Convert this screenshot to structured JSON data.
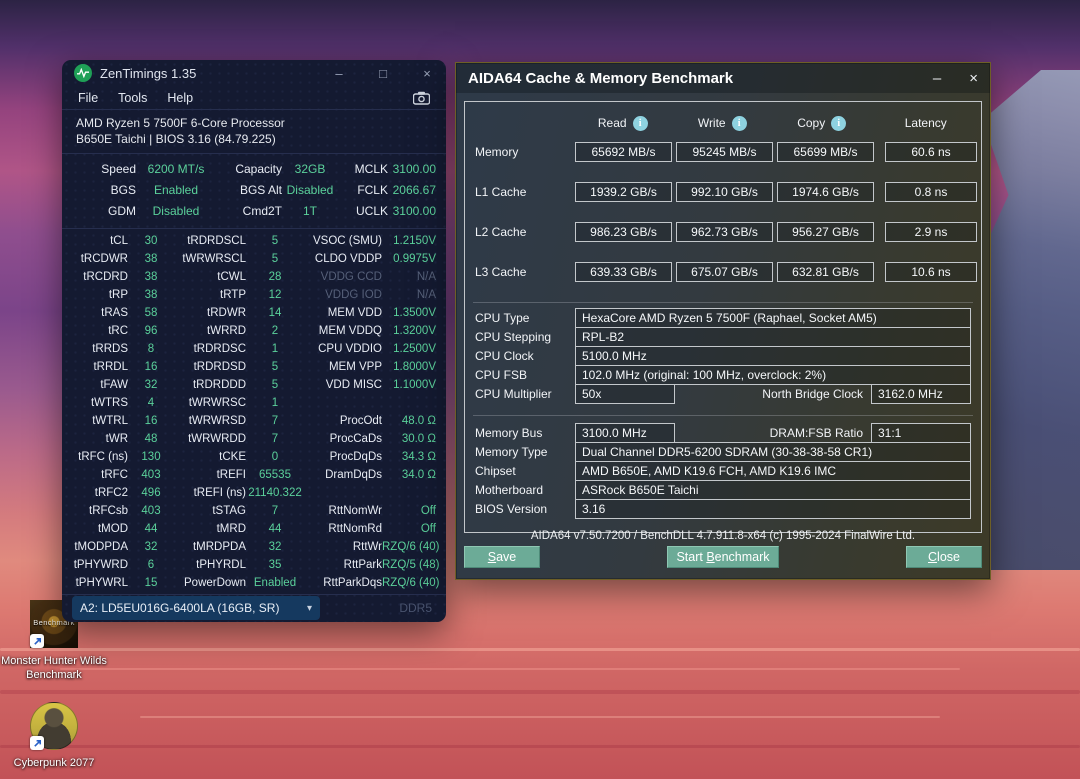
{
  "colors": {
    "accent_green": "#5bd19b",
    "button_teal": "#6cab97",
    "info_icon_blue": "#8ed2e0",
    "zentimings_bg": "#141a31"
  },
  "icons": {
    "minimize": "–",
    "maximize": "□",
    "close": "×",
    "dropdown_caret": "▾",
    "info": "i"
  },
  "zentimings": {
    "title": "ZenTimings 1.35",
    "menu": {
      "file": "File",
      "tools": "Tools",
      "help": "Help"
    },
    "cpu_line1": "AMD Ryzen 5 7500F 6-Core Processor",
    "cpu_line2": "B650E Taichi | BIOS 3.16 (84.79.225)",
    "speed_rows": [
      [
        "Speed",
        "6200 MT/s",
        "Capacity",
        "32GB",
        "MCLK",
        "3100.00"
      ],
      [
        "BGS",
        "Enabled",
        "BGS Alt",
        "Disabled",
        "FCLK",
        "2066.67"
      ],
      [
        "GDM",
        "Disabled",
        "Cmd2T",
        "1T",
        "UCLK",
        "3100.00"
      ]
    ],
    "timing_rows": [
      [
        "tCL",
        "30",
        "tRDRDSCL",
        "5",
        "VSOC (SMU)",
        "1.2150V"
      ],
      [
        "tRCDWR",
        "38",
        "tWRWRSCL",
        "5",
        "CLDO VDDP",
        "0.9975V"
      ],
      [
        "tRCDRD",
        "38",
        "tCWL",
        "28",
        "VDDG CCD",
        "N/A"
      ],
      [
        "tRP",
        "38",
        "tRTP",
        "12",
        "VDDG IOD",
        "N/A"
      ],
      [
        "tRAS",
        "58",
        "tRDWR",
        "14",
        "MEM VDD",
        "1.3500V"
      ],
      [
        "tRC",
        "96",
        "tWRRD",
        "2",
        "MEM VDDQ",
        "1.3200V"
      ],
      [
        "tRRDS",
        "8",
        "tRDRDSC",
        "1",
        "CPU VDDIO",
        "1.2500V"
      ],
      [
        "tRRDL",
        "16",
        "tRDRDSD",
        "5",
        "MEM VPP",
        "1.8000V"
      ],
      [
        "tFAW",
        "32",
        "tRDRDDD",
        "5",
        "VDD MISC",
        "1.1000V"
      ],
      [
        "tWTRS",
        "4",
        "tWRWRSC",
        "1",
        "",
        ""
      ],
      [
        "tWTRL",
        "16",
        "tWRWRSD",
        "7",
        "ProcOdt",
        "48.0 Ω"
      ],
      [
        "tWR",
        "48",
        "tWRWRDD",
        "7",
        "ProcCaDs",
        "30.0 Ω"
      ],
      [
        "tRFC (ns)",
        "130",
        "tCKE",
        "0",
        "ProcDqDs",
        "34.3 Ω"
      ],
      [
        "tRFC",
        "403",
        "tREFI",
        "65535",
        "DramDqDs",
        "34.0 Ω"
      ],
      [
        "tRFC2",
        "496",
        "tREFI (ns)",
        "21140.322",
        "",
        ""
      ],
      [
        "tRFCsb",
        "403",
        "tSTAG",
        "7",
        "RttNomWr",
        "Off"
      ],
      [
        "tMOD",
        "44",
        "tMRD",
        "44",
        "RttNomRd",
        "Off"
      ],
      [
        "tMODPDA",
        "32",
        "tMRDPDA",
        "32",
        "RttWr",
        "RZQ/6 (40)"
      ],
      [
        "tPHYWRD",
        "6",
        "tPHYRDL",
        "35",
        "RttPark",
        "RZQ/5 (48)"
      ],
      [
        "tPHYWRL",
        "15",
        "PowerDown",
        "Enabled",
        "RttParkDqs",
        "RZQ/6 (40)"
      ]
    ],
    "dimm_selector": "A2: LD5EU016G-6400LA (16GB, SR)",
    "memory_standard": "DDR5"
  },
  "aida": {
    "title": "AIDA64 Cache & Memory Benchmark",
    "columns": [
      "Read",
      "Write",
      "Copy",
      "Latency"
    ],
    "bench_rows": [
      {
        "label": "Memory",
        "read": "65692 MB/s",
        "write": "95245 MB/s",
        "copy": "65699 MB/s",
        "latency": "60.6 ns"
      },
      {
        "label": "L1 Cache",
        "read": "1939.2 GB/s",
        "write": "992.10 GB/s",
        "copy": "1974.6 GB/s",
        "latency": "0.8 ns"
      },
      {
        "label": "L2 Cache",
        "read": "986.23 GB/s",
        "write": "962.73 GB/s",
        "copy": "956.27 GB/s",
        "latency": "2.9 ns"
      },
      {
        "label": "L3 Cache",
        "read": "639.33 GB/s",
        "write": "675.07 GB/s",
        "copy": "632.81 GB/s",
        "latency": "10.6 ns"
      }
    ],
    "cpu": {
      "type_label": "CPU Type",
      "type": "HexaCore AMD Ryzen 5 7500F  (Raphael, Socket AM5)",
      "stepping_label": "CPU Stepping",
      "stepping": "RPL-B2",
      "clock_label": "CPU Clock",
      "clock": "5100.0 MHz",
      "fsb_label": "CPU FSB",
      "fsb": "102.0 MHz  (original: 100 MHz, overclock: 2%)",
      "multiplier_label": "CPU Multiplier",
      "multiplier": "50x",
      "nb_label": "North Bridge Clock",
      "nb_clock": "3162.0 MHz"
    },
    "memory": {
      "bus_label": "Memory Bus",
      "bus": "3100.0 MHz",
      "ratio_label": "DRAM:FSB Ratio",
      "ratio": "31:1",
      "type_label": "Memory Type",
      "type": "Dual Channel DDR5-6200 SDRAM  (30-38-38-58 CR1)",
      "chipset_label": "Chipset",
      "chipset": "AMD B650E, AMD K19.6 FCH, AMD K19.6 IMC",
      "motherboard_label": "Motherboard",
      "motherboard": "ASRock B650E Taichi",
      "bios_label": "BIOS Version",
      "bios": "3.16"
    },
    "footer": "AIDA64 v7.50.7200 / BenchDLL 4.7.911.8-x64  (c) 1995-2024 FinalWire Ltd.",
    "buttons": {
      "save_u": "S",
      "save_rest": "ave",
      "start_pre": "Start ",
      "start_u": "B",
      "start_rest": "enchmark",
      "close_u": "C",
      "close_rest": "lose"
    }
  },
  "desktop": {
    "icons": [
      {
        "label": "Monster Hunter Wilds Benchmark",
        "badge_text": "Benchmark"
      },
      {
        "label": "Cyberpunk 2077"
      }
    ]
  }
}
